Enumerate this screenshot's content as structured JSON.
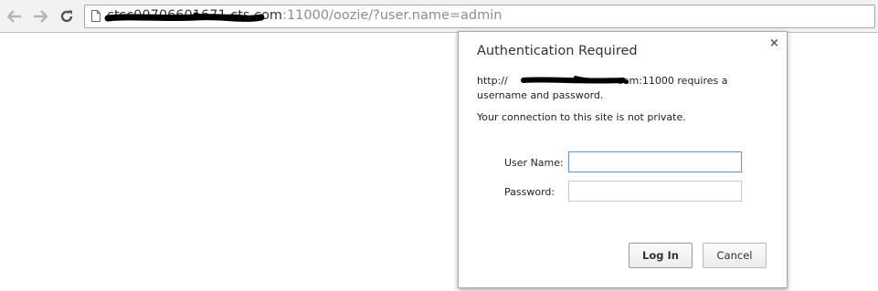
{
  "browser": {
    "back_icon": "arrow-left-icon",
    "forward_icon": "arrow-right-icon",
    "reload_icon": "reload-icon",
    "page_icon": "page-icon",
    "url_host": "ctsc00706601671.cts.com",
    "url_path": ":11000/oozie/?user.name=admin"
  },
  "dialog": {
    "title": "Authentication Required",
    "close_label": "×",
    "message_prefix": "http://",
    "message_suffix": "com:11000 requires a username and password.",
    "warning": "Your connection to this site is not private.",
    "username_label": "User Name:",
    "username_value": "",
    "password_label": "Password:",
    "password_value": "",
    "login_label": "Log In",
    "cancel_label": "Cancel"
  },
  "colors": {
    "toolbar_bg": "#f2f2f2",
    "focus_border": "#6d96cf",
    "redaction": "#000000"
  }
}
